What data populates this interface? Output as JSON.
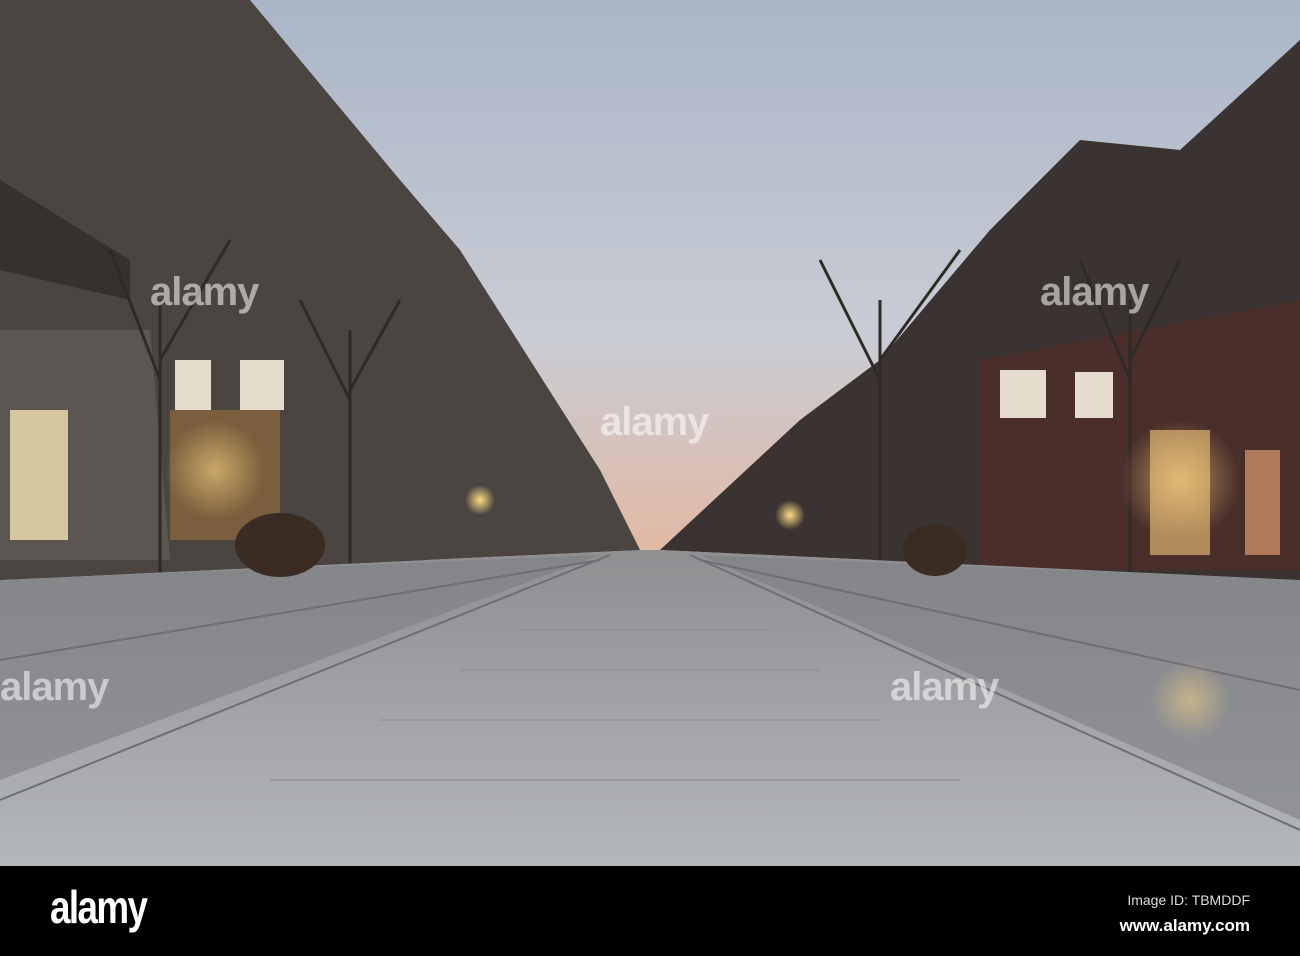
{
  "photo": {
    "subject": "Pedestrian street at dusk",
    "colors": {
      "sky_top": "#aeb8c8",
      "sky_horizon": "#d9b9a8",
      "pavement": "#9a9ea3",
      "building_dark": "#3e3a37",
      "lamp_glow": "#f4c66a"
    }
  },
  "watermark": {
    "text": "alamy"
  },
  "footer": {
    "logo": "alamy",
    "image_id": "Image ID: TBMDDF",
    "website": "www.alamy.com"
  }
}
